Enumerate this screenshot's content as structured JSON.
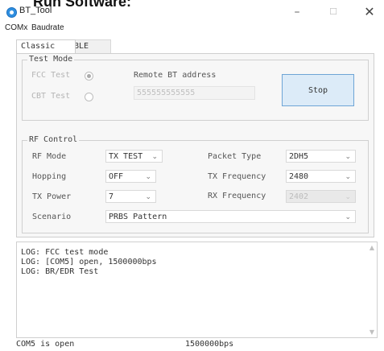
{
  "doc_heading": "Run Software:",
  "window": {
    "title": "BT_Tool"
  },
  "titlebar": {
    "min_glyph": "–",
    "max_glyph": "☐",
    "close_glyph": "✕"
  },
  "menu": [
    "COMx",
    "Baudrate"
  ],
  "tabs": [
    "Classic",
    "BLE"
  ],
  "test_mode": {
    "title": "Test Mode",
    "fcc_label": "FCC Test",
    "fcc_checked": true,
    "cbt_label": "CBT Test",
    "cbt_checked": false,
    "remote_label": "Remote BT address",
    "remote_value": "555555555555",
    "stop_label": "Stop"
  },
  "rf_control": {
    "title": "RF Control",
    "rf_mode_label": "RF Mode",
    "rf_mode_value": "TX TEST",
    "packet_type_label": "Packet Type",
    "packet_type_value": "2DH5",
    "hopping_label": "Hopping",
    "hopping_value": "OFF",
    "tx_freq_label": "TX Frequency",
    "tx_freq_value": "2480",
    "tx_power_label": "TX Power",
    "tx_power_value": "7",
    "rx_freq_label": "RX Frequency",
    "rx_freq_value": "2402",
    "scenario_label": "Scenario",
    "scenario_value": "PRBS Pattern"
  },
  "log": {
    "lines": [
      "LOG: FCC test mode",
      "LOG: [COM5] open, 1500000bps",
      "LOG: BR/EDR Test"
    ]
  },
  "status": {
    "port": "COM5 is open",
    "baud": "1500000bps"
  },
  "icons": {
    "app_icon": "app-icon",
    "dropdown": "chevron-down-icon"
  },
  "colors": {
    "stop_button_bg": "#dcebf8",
    "stop_button_border": "#6ea5d6",
    "app_icon": "#2f8fe0"
  }
}
